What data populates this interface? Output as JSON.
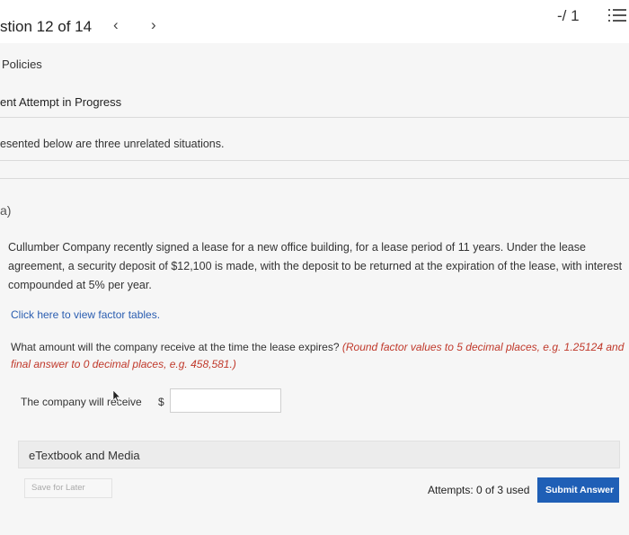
{
  "header": {
    "question_title": "stion 12 of 14",
    "prev_icon": "chevron-left-icon",
    "next_icon": "chevron-right-icon",
    "score": "-/ 1",
    "list_icon": "list-icon"
  },
  "policies_link": "Policies",
  "attempt_status": "ent Attempt in Progress",
  "intro_text": "esented below are three unrelated situations.",
  "part_label": "a)",
  "problem_text": "Cullumber Company recently signed a lease for a new office building, for a lease period of 11 years. Under the lease agreement, a security deposit of $12,100 is made, with the deposit to be returned at the expiration of the lease, with interest compounded at 5% per year.",
  "factor_link": "Click here to view factor tables.",
  "question": {
    "main": "What amount will the company receive at the time the lease expires? ",
    "instruction": "(Round factor values to 5 decimal places, e.g. 1.25124 and final answer to 0 decimal places, e.g. 458,581.)"
  },
  "answer": {
    "label": "The company will receive",
    "currency": "$",
    "value": ""
  },
  "etextbook_label": "eTextbook and Media",
  "footer": {
    "save_label": "Save for Later",
    "attempts": "Attempts: 0 of 3 used",
    "submit_label": "Submit Answer"
  },
  "colors": {
    "link": "#2a5db0",
    "instruction": "#c0392b",
    "submit": "#1f5fb6"
  }
}
